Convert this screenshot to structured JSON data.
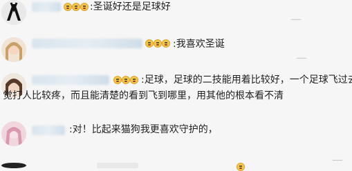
{
  "comments": [
    {
      "text": "圣诞好还是足球好"
    },
    {
      "text": "我喜欢圣诞"
    },
    {
      "line1": "足球，足球的二技能用着比较好，一个足球飞过去",
      "line2": "觉打人比较疼，而且能清楚的看到飞到哪里，用其他的根本看不清"
    },
    {
      "text": "对！比起来猫狗我更喜欢守护的，"
    }
  ],
  "separator": ":",
  "faint_marks": [
    "—",
    "—",
    "—"
  ],
  "colors": {
    "background": "#f6f6f6",
    "text": "#1f1f1f",
    "emoji": "#f6c64a"
  }
}
